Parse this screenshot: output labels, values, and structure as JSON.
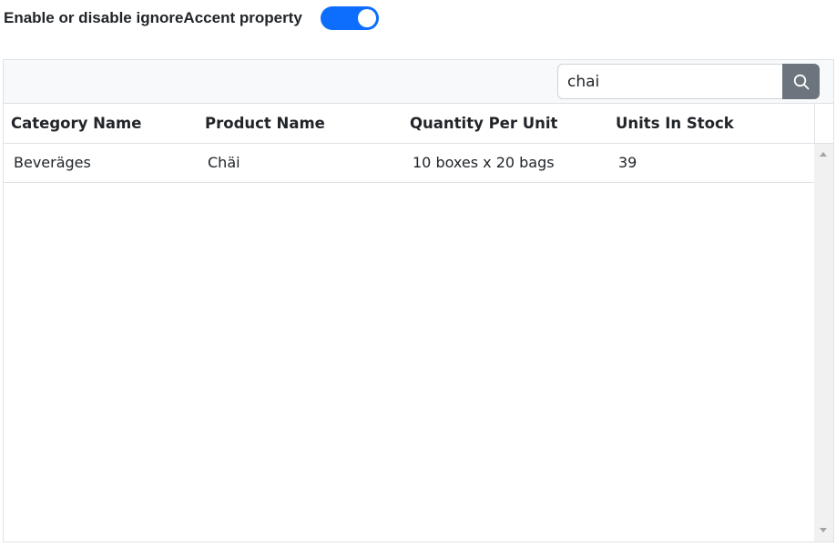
{
  "toggle": {
    "label": "Enable or disable ignoreAccent property",
    "checked": true,
    "accent_color": "#0d6efd"
  },
  "search": {
    "value": "chai",
    "icon": "search-icon"
  },
  "grid": {
    "columns": [
      "Category Name",
      "Product Name",
      "Quantity Per Unit",
      "Units In Stock"
    ],
    "rows": [
      [
        "Beveräges",
        "Chäi",
        "10 boxes x 20 bags",
        "39"
      ]
    ]
  }
}
